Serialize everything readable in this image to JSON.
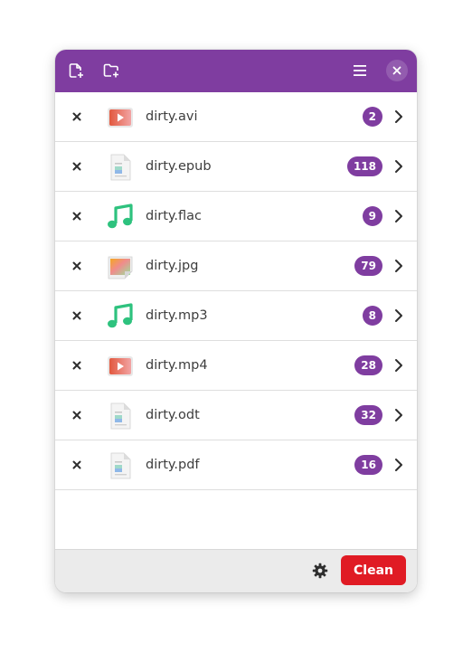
{
  "header": {
    "buttons": [
      {
        "name": "add-files-button",
        "icon": "file-plus-icon"
      },
      {
        "name": "add-folder-button",
        "icon": "folder-plus-icon"
      },
      {
        "name": "main-menu-button",
        "icon": "hamburger-menu-icon"
      },
      {
        "name": "close-window-button",
        "icon": "close-icon"
      }
    ],
    "accent_color": "#7f3da0"
  },
  "files": [
    {
      "name": "dirty.avi",
      "count": "2",
      "icon": "video-file-icon"
    },
    {
      "name": "dirty.epub",
      "count": "118",
      "icon": "document-file-icon"
    },
    {
      "name": "dirty.flac",
      "count": "9",
      "icon": "audio-file-icon"
    },
    {
      "name": "dirty.jpg",
      "count": "79",
      "icon": "image-file-icon"
    },
    {
      "name": "dirty.mp3",
      "count": "8",
      "icon": "audio-file-icon"
    },
    {
      "name": "dirty.mp4",
      "count": "28",
      "icon": "video-file-icon"
    },
    {
      "name": "dirty.odt",
      "count": "32",
      "icon": "document-file-icon"
    },
    {
      "name": "dirty.pdf",
      "count": "16",
      "icon": "document-file-icon"
    }
  ],
  "footer": {
    "settings_icon": "gear-icon",
    "clean_label": "Clean",
    "clean_color": "#e01b24"
  }
}
